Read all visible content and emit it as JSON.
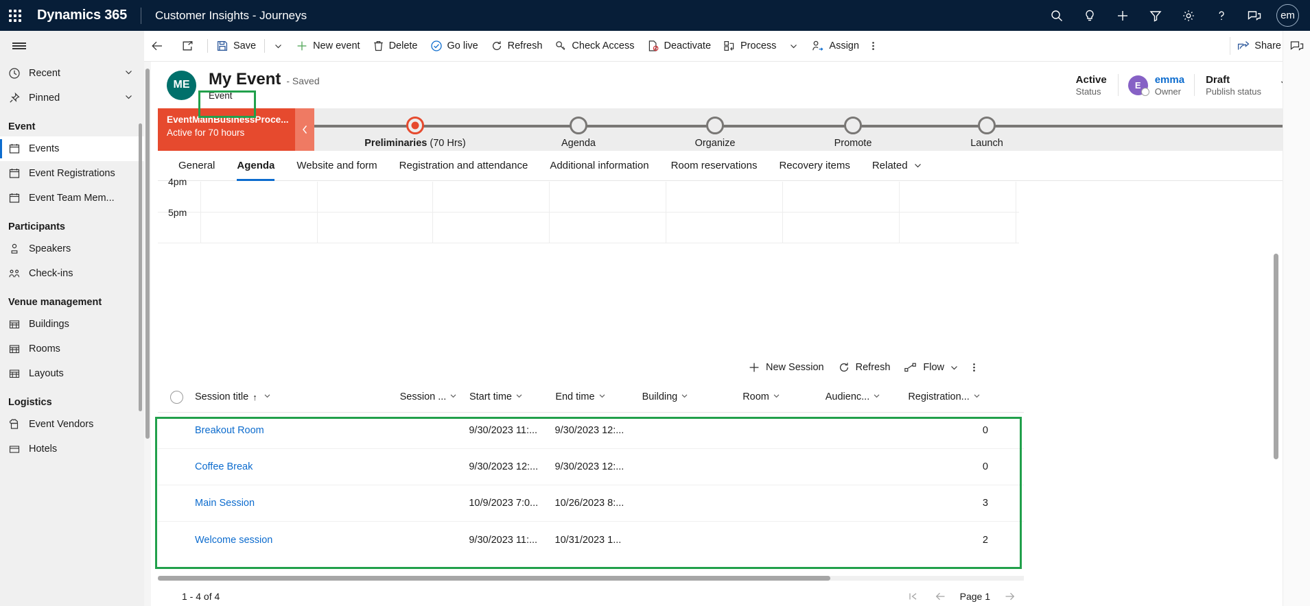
{
  "topnav": {
    "waffle_label": "app-launcher",
    "brand": "Dynamics 365",
    "app_name": "Customer Insights - Journeys",
    "icons": [
      "search-icon",
      "lightbulb-icon",
      "plus-icon",
      "filter-icon",
      "gear-icon",
      "help-icon",
      "chat-icon"
    ],
    "avatar_initials": "em"
  },
  "sidebar": {
    "recent": "Recent",
    "pinned": "Pinned",
    "groups": [
      {
        "title": "Event",
        "items": [
          {
            "label": "Events",
            "icon": "calendar-icon",
            "selected": true
          },
          {
            "label": "Event Registrations",
            "icon": "calendar-icon",
            "selected": false
          },
          {
            "label": "Event Team Mem...",
            "icon": "calendar-icon",
            "selected": false
          }
        ]
      },
      {
        "title": "Participants",
        "items": [
          {
            "label": "Speakers",
            "icon": "person-icon",
            "selected": false
          },
          {
            "label": "Check-ins",
            "icon": "people-icon",
            "selected": false
          }
        ]
      },
      {
        "title": "Venue management",
        "items": [
          {
            "label": "Buildings",
            "icon": "building-icon",
            "selected": false
          },
          {
            "label": "Rooms",
            "icon": "building-icon",
            "selected": false
          },
          {
            "label": "Layouts",
            "icon": "building-icon",
            "selected": false
          }
        ]
      },
      {
        "title": "Logistics",
        "items": [
          {
            "label": "Event Vendors",
            "icon": "vendor-icon",
            "selected": false
          },
          {
            "label": "Hotels",
            "icon": "hotel-icon",
            "selected": false
          }
        ]
      }
    ]
  },
  "commandbar": {
    "back": "back-arrow",
    "popout": "open-in-new-window",
    "save": "Save",
    "new_event": "New event",
    "delete": "Delete",
    "go_live": "Go live",
    "refresh": "Refresh",
    "check_access": "Check Access",
    "deactivate": "Deactivate",
    "process": "Process",
    "assign": "Assign",
    "overflow": "more-commands",
    "share": "Share"
  },
  "record": {
    "avatar_initials": "ME",
    "title": "My Event",
    "saved_state": "- Saved",
    "entity": "Event",
    "status_value": "Active",
    "status_label": "Status",
    "owner_initial": "E",
    "owner_value": "emma",
    "owner_label": "Owner",
    "publish_value": "Draft",
    "publish_label": "Publish status"
  },
  "bpf": {
    "name": "EventMainBusinessProce...",
    "duration": "Active for 70 hours",
    "stages": [
      {
        "label": "Preliminaries",
        "suffix": "(70 Hrs)",
        "active": true
      },
      {
        "label": "Agenda",
        "suffix": "",
        "active": false
      },
      {
        "label": "Organize",
        "suffix": "",
        "active": false
      },
      {
        "label": "Promote",
        "suffix": "",
        "active": false
      },
      {
        "label": "Launch",
        "suffix": "",
        "active": false
      }
    ],
    "accent_color": "#e64a2e"
  },
  "tabs": [
    {
      "label": "General",
      "active": false
    },
    {
      "label": "Agenda",
      "active": true
    },
    {
      "label": "Website and form",
      "active": false
    },
    {
      "label": "Registration and attendance",
      "active": false
    },
    {
      "label": "Additional information",
      "active": false
    },
    {
      "label": "Room reservations",
      "active": false
    },
    {
      "label": "Recovery items",
      "active": false
    },
    {
      "label": "Related",
      "active": false
    }
  ],
  "calendar": {
    "times": [
      "4pm",
      "5pm"
    ]
  },
  "subgrid_toolbar": {
    "new_session": "New Session",
    "refresh": "Refresh",
    "flow": "Flow",
    "overflow": "more-grid-commands"
  },
  "grid": {
    "columns": [
      {
        "label": "Session title",
        "sorted": "asc",
        "align": "left"
      },
      {
        "label": "Session ...",
        "sorted": "",
        "align": "left"
      },
      {
        "label": "Start time",
        "sorted": "",
        "align": "left"
      },
      {
        "label": "End time",
        "sorted": "",
        "align": "left"
      },
      {
        "label": "Building",
        "sorted": "",
        "align": "left"
      },
      {
        "label": "Room",
        "sorted": "",
        "align": "left"
      },
      {
        "label": "Audienc...",
        "sorted": "",
        "align": "left"
      },
      {
        "label": "Registration...",
        "sorted": "",
        "align": "right"
      }
    ],
    "rows": [
      {
        "title": "Breakout Room",
        "session_type": "",
        "start_time": "9/30/2023 11:...",
        "end_time": "9/30/2023 12:...",
        "building": "",
        "room": "",
        "audience": "",
        "registration": "0"
      },
      {
        "title": "Coffee Break",
        "session_type": "",
        "start_time": "9/30/2023 12:...",
        "end_time": "9/30/2023 12:...",
        "building": "",
        "room": "",
        "audience": "",
        "registration": "0"
      },
      {
        "title": "Main Session",
        "session_type": "",
        "start_time": "10/9/2023 7:0...",
        "end_time": "10/26/2023 8:...",
        "building": "",
        "room": "",
        "audience": "",
        "registration": "3"
      },
      {
        "title": "Welcome session",
        "session_type": "",
        "start_time": "9/30/2023 11:...",
        "end_time": "10/31/2023 1...",
        "building": "",
        "room": "",
        "audience": "",
        "registration": "2"
      }
    ],
    "footer_count": "1 - 4 of 4",
    "page_label": "Page 1"
  },
  "highlight_color": "#21a04b"
}
